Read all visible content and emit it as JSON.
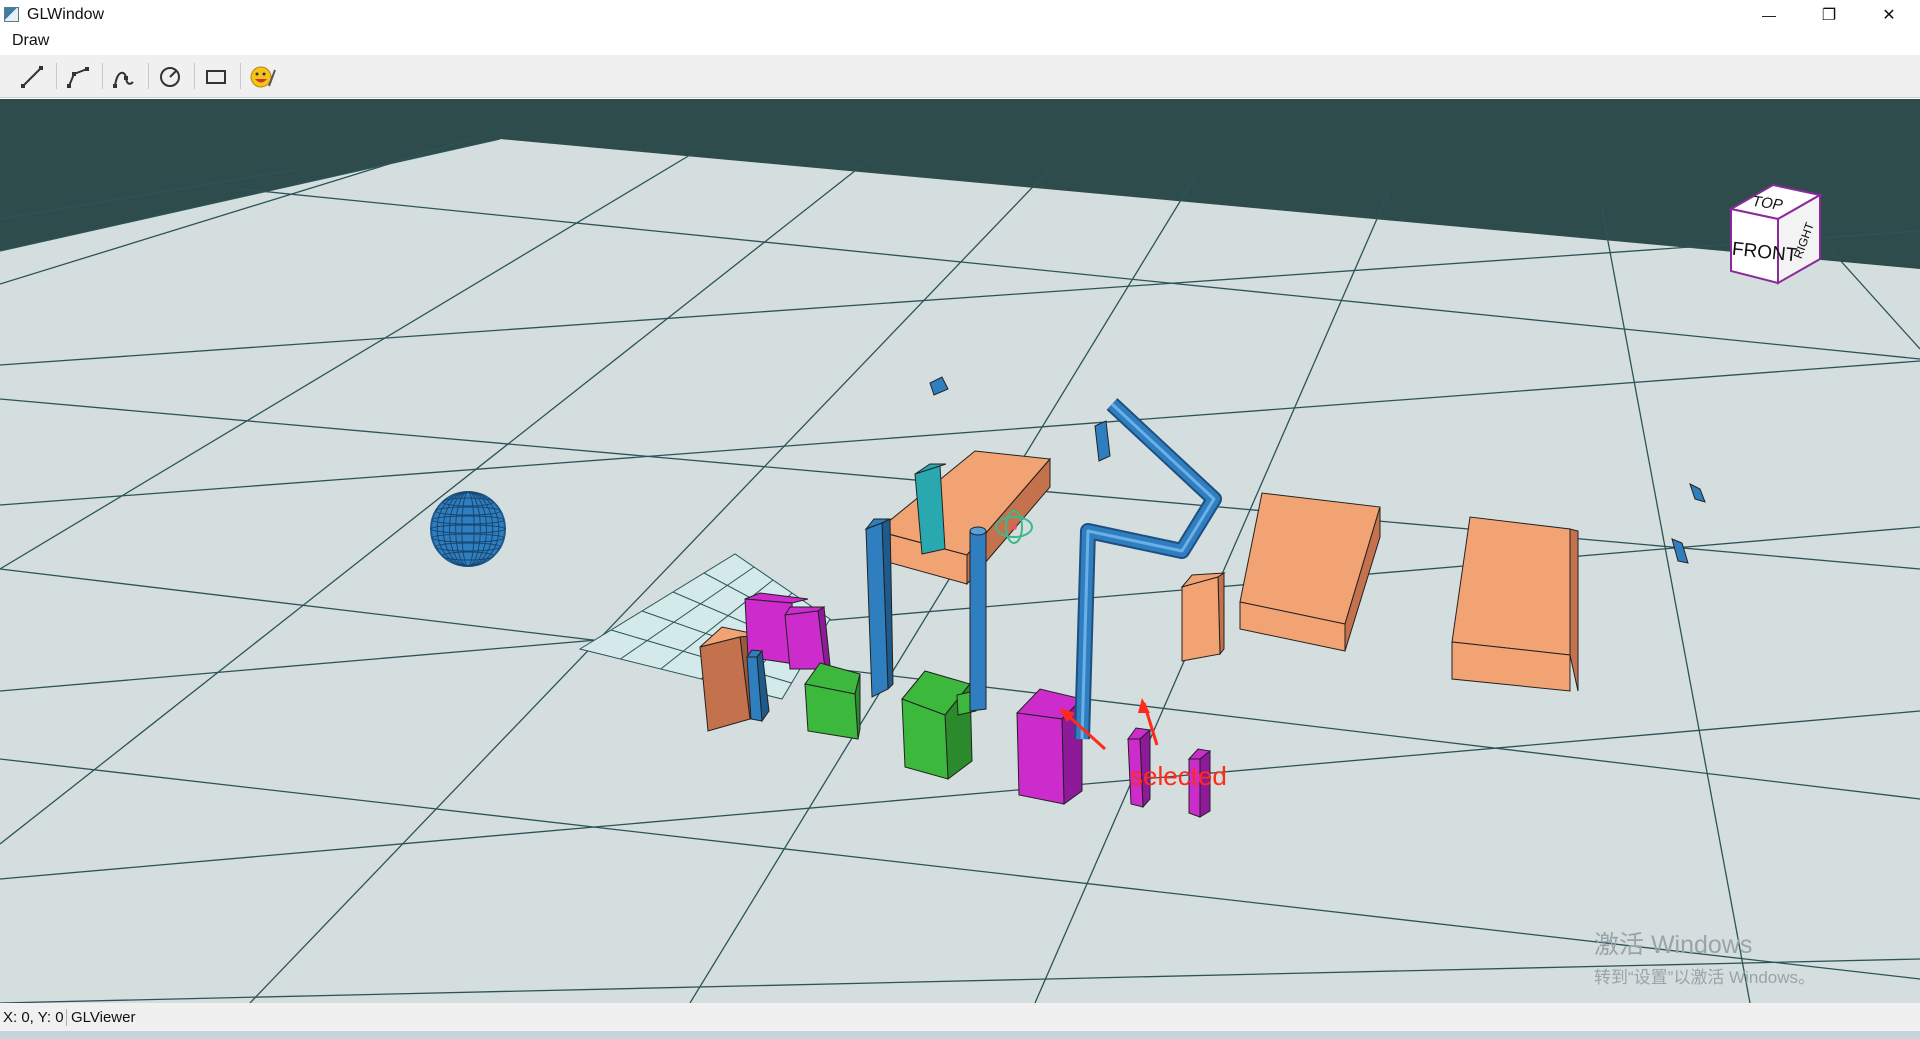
{
  "window": {
    "title": "GLWindow",
    "minimize_glyph": "—",
    "restore_glyph": "❐",
    "close_glyph": "✕"
  },
  "menu": {
    "items": [
      {
        "label": "Draw"
      }
    ]
  },
  "toolbar": {
    "tools": [
      {
        "name": "line-icon"
      },
      {
        "name": "polyline-icon"
      },
      {
        "name": "spline-icon"
      },
      {
        "name": "circle-icon"
      },
      {
        "name": "rectangle-icon"
      },
      {
        "name": "emoji-icon"
      }
    ]
  },
  "scene": {
    "colors": {
      "sky": "#2f4c4c",
      "floor": "#d5dede",
      "grid_line": "#2c5458",
      "salmon": "#f2a373",
      "salmon_dark": "#c4714d",
      "magenta": "#cc2ccc",
      "magenta_dark": "#8e1a9a",
      "green": "#3cb83c",
      "green_dark": "#2b8a2b",
      "blue": "#2f7fc0",
      "blue_dark": "#1f5a8c",
      "teal": "#2aa8b0",
      "annotation": "#ff2a1a"
    },
    "view_cube": {
      "top": "TOP",
      "front": "FRONT",
      "right": "RIGHT"
    },
    "annotation": {
      "label": "selected"
    }
  },
  "status": {
    "coords": "X: 0, Y: 0",
    "viewer": "GLViewer"
  },
  "watermark": {
    "line1": "激活 Windows",
    "line2": "转到“设置”以激活 Windows。"
  }
}
